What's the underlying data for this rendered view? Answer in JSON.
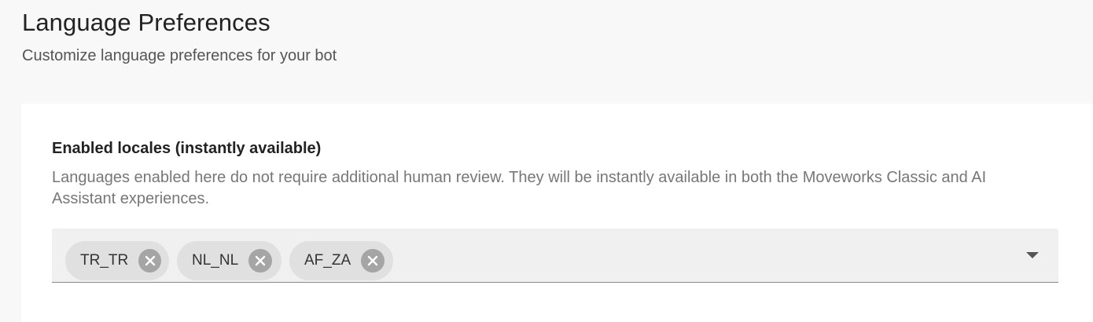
{
  "header": {
    "title": "Language Preferences",
    "subtitle": "Customize language preferences for your bot"
  },
  "enabled_locales": {
    "title": "Enabled locales (instantly available)",
    "description": "Languages enabled here do not require additional human review. They will be instantly available in both the Moveworks Classic and AI Assistant experiences.",
    "chips": [
      {
        "label": "TR_TR",
        "remove_icon": "close-circle-icon"
      },
      {
        "label": "NL_NL",
        "remove_icon": "close-circle-icon"
      },
      {
        "label": "AF_ZA",
        "remove_icon": "close-circle-icon"
      }
    ],
    "dropdown_icon": "arrow-drop-down-icon"
  },
  "colors": {
    "page_background": "#f8f8f8",
    "card_background": "#ffffff",
    "select_background": "#f0f0f0",
    "chip_background": "#e0e0e0",
    "chip_remove_icon": "#a5a5a5"
  }
}
